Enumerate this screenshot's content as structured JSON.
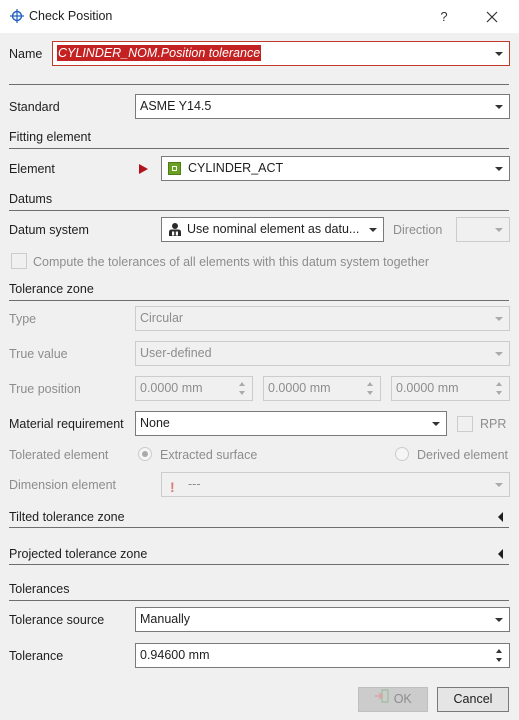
{
  "window": {
    "title": "Check Position",
    "help_label": "?"
  },
  "name": {
    "label": "Name",
    "value": "CYLINDER_NOM.Position tolerance"
  },
  "standard": {
    "label": "Standard",
    "value": "ASME Y14.5"
  },
  "fitting_element": {
    "section": "Fitting element",
    "element_label": "Element",
    "element_value": "CYLINDER_ACT"
  },
  "datums": {
    "section": "Datums",
    "datum_system_label": "Datum system",
    "datum_system_value": "Use nominal element as datu...",
    "direction_label": "Direction",
    "direction_value": "",
    "compute_together_label": "Compute the tolerances of all elements with this datum system together"
  },
  "tolerance_zone": {
    "section": "Tolerance zone",
    "type_label": "Type",
    "type_value": "Circular",
    "true_value_label": "True value",
    "true_value_value": "User-defined",
    "true_position_label": "True position",
    "true_position_values": [
      "0.0000 mm",
      "0.0000 mm",
      "0.0000 mm"
    ],
    "material_requirement_label": "Material requirement",
    "material_requirement_value": "None",
    "rpr_label": "RPR",
    "toleranced_element_label": "Tolerated element",
    "extracted_surface_label": "Extracted surface",
    "derived_element_label": "Derived element",
    "dimension_element_label": "Dimension element",
    "dimension_element_value": "---"
  },
  "tilted_zone": {
    "section": "Tilted tolerance zone"
  },
  "projected_zone": {
    "section": "Projected tolerance zone"
  },
  "tolerances": {
    "section": "Tolerances",
    "source_label": "Tolerance source",
    "source_value": "Manually",
    "tolerance_label": "Tolerance",
    "tolerance_value": "0.94600 mm"
  },
  "buttons": {
    "ok": "OK",
    "cancel": "Cancel"
  },
  "colors": {
    "accent_red": "#c42222",
    "element_icon_green": "#6aa121",
    "disabled_text": "#8d8d8d"
  }
}
